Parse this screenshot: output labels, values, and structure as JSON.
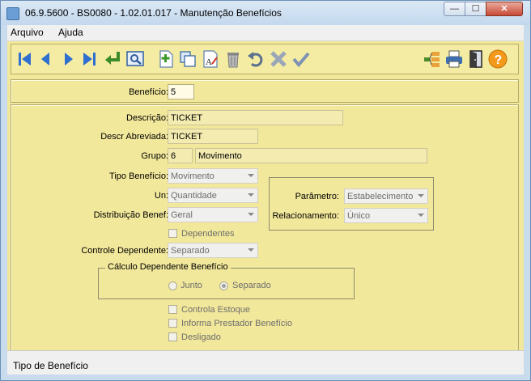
{
  "window": {
    "title": "06.9.5600 - BS0080 - 1.02.01.017 - Manutenção Benefícios",
    "min_glyph": "—",
    "max_glyph": "☐",
    "close_glyph": "✕"
  },
  "menu": {
    "items": [
      "Arquivo",
      "Ajuda"
    ]
  },
  "toolbar": {
    "buttons": [
      "first-record-icon",
      "previous-record-icon",
      "next-record-icon",
      "last-record-icon",
      "go-to-icon",
      "search-icon",
      "new-record-icon",
      "copy-record-icon",
      "edit-record-icon",
      "delete-record-icon",
      "undo-icon",
      "cancel-icon",
      "save-icon",
      "tree-view-icon",
      "print-icon",
      "exit-door-icon",
      "help-icon"
    ]
  },
  "header_form": {
    "beneficio_label": "Benefício:",
    "beneficio_value": "5"
  },
  "form": {
    "descricao_label": "Descrição:",
    "descricao_value": "TICKET",
    "descr_abreviada_label": "Descr Abreviada:",
    "descr_abreviada_value": "TICKET",
    "grupo_label": "Grupo:",
    "grupo_code": "6",
    "grupo_desc": "Movimento",
    "tipo_beneficio_label": "Tipo Benefício:",
    "tipo_beneficio_value": "Movimento",
    "un_label": "Un:",
    "un_value": "Quantidade",
    "distribuicao_label": "Distribuição Benef:",
    "distribuicao_value": "Geral",
    "parametro_label": "Parâmetro:",
    "parametro_value": "Estabelecimento",
    "relacionamento_label": "Relacionamento:",
    "relacionamento_value": "Único",
    "dependentes_label": "Dependentes",
    "controle_dependente_label": "Controle Dependente:",
    "controle_dependente_value": "Separado",
    "calculo_group_title": "Cálculo Dependente Benefício",
    "radio_junto_label": "Junto",
    "radio_separado_label": "Separado",
    "radio_selected": "Separado",
    "controla_estoque_label": "Controla Estoque",
    "informa_prestador_label": "Informa Prestador Benefício",
    "desligado_label": "Desligado"
  },
  "status": {
    "text": "Tipo de Benefício"
  },
  "colors": {
    "panel_bg": "#f2e89b",
    "nav_blue": "#2f6fd0",
    "confirm_green": "#4a9a2e",
    "help_orange": "#f39a1d"
  }
}
